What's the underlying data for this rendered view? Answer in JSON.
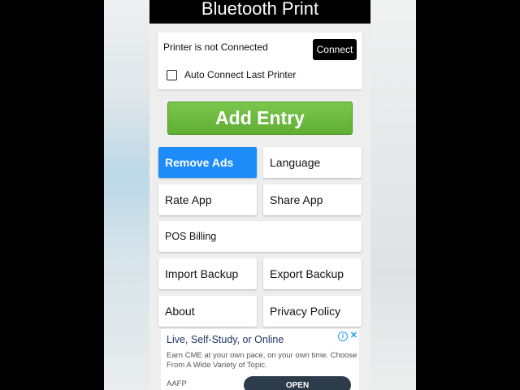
{
  "app": {
    "title": "Bluetooth Print"
  },
  "printer": {
    "status": "Printer is not Connected",
    "connect_label": "Connect",
    "auto_connect_label": "Auto Connect Last Printer",
    "auto_connect_checked": false
  },
  "add_entry_label": "Add Entry",
  "menu": {
    "remove_ads": "Remove Ads",
    "language": "Language",
    "rate_app": "Rate App",
    "share_app": "Share App",
    "pos_billing": "POS Billing",
    "import_backup": "Import Backup",
    "export_backup": "Export Backup",
    "about": "About",
    "privacy_policy": "Privacy Policy"
  },
  "ad": {
    "title": "Live, Self-Study, or Online",
    "body": "Earn CME at your own pace, on your own time. Choose From A Wide Variety of Topic.",
    "advertiser": "AAFP",
    "cta": "OPEN",
    "info_icon": "info-icon",
    "close_icon": "close-icon"
  },
  "colors": {
    "accent_blue": "#1d8cf8",
    "add_entry_green": "#6bb83d",
    "title_bar": "#000000",
    "ad_button": "#2d3c4a"
  }
}
